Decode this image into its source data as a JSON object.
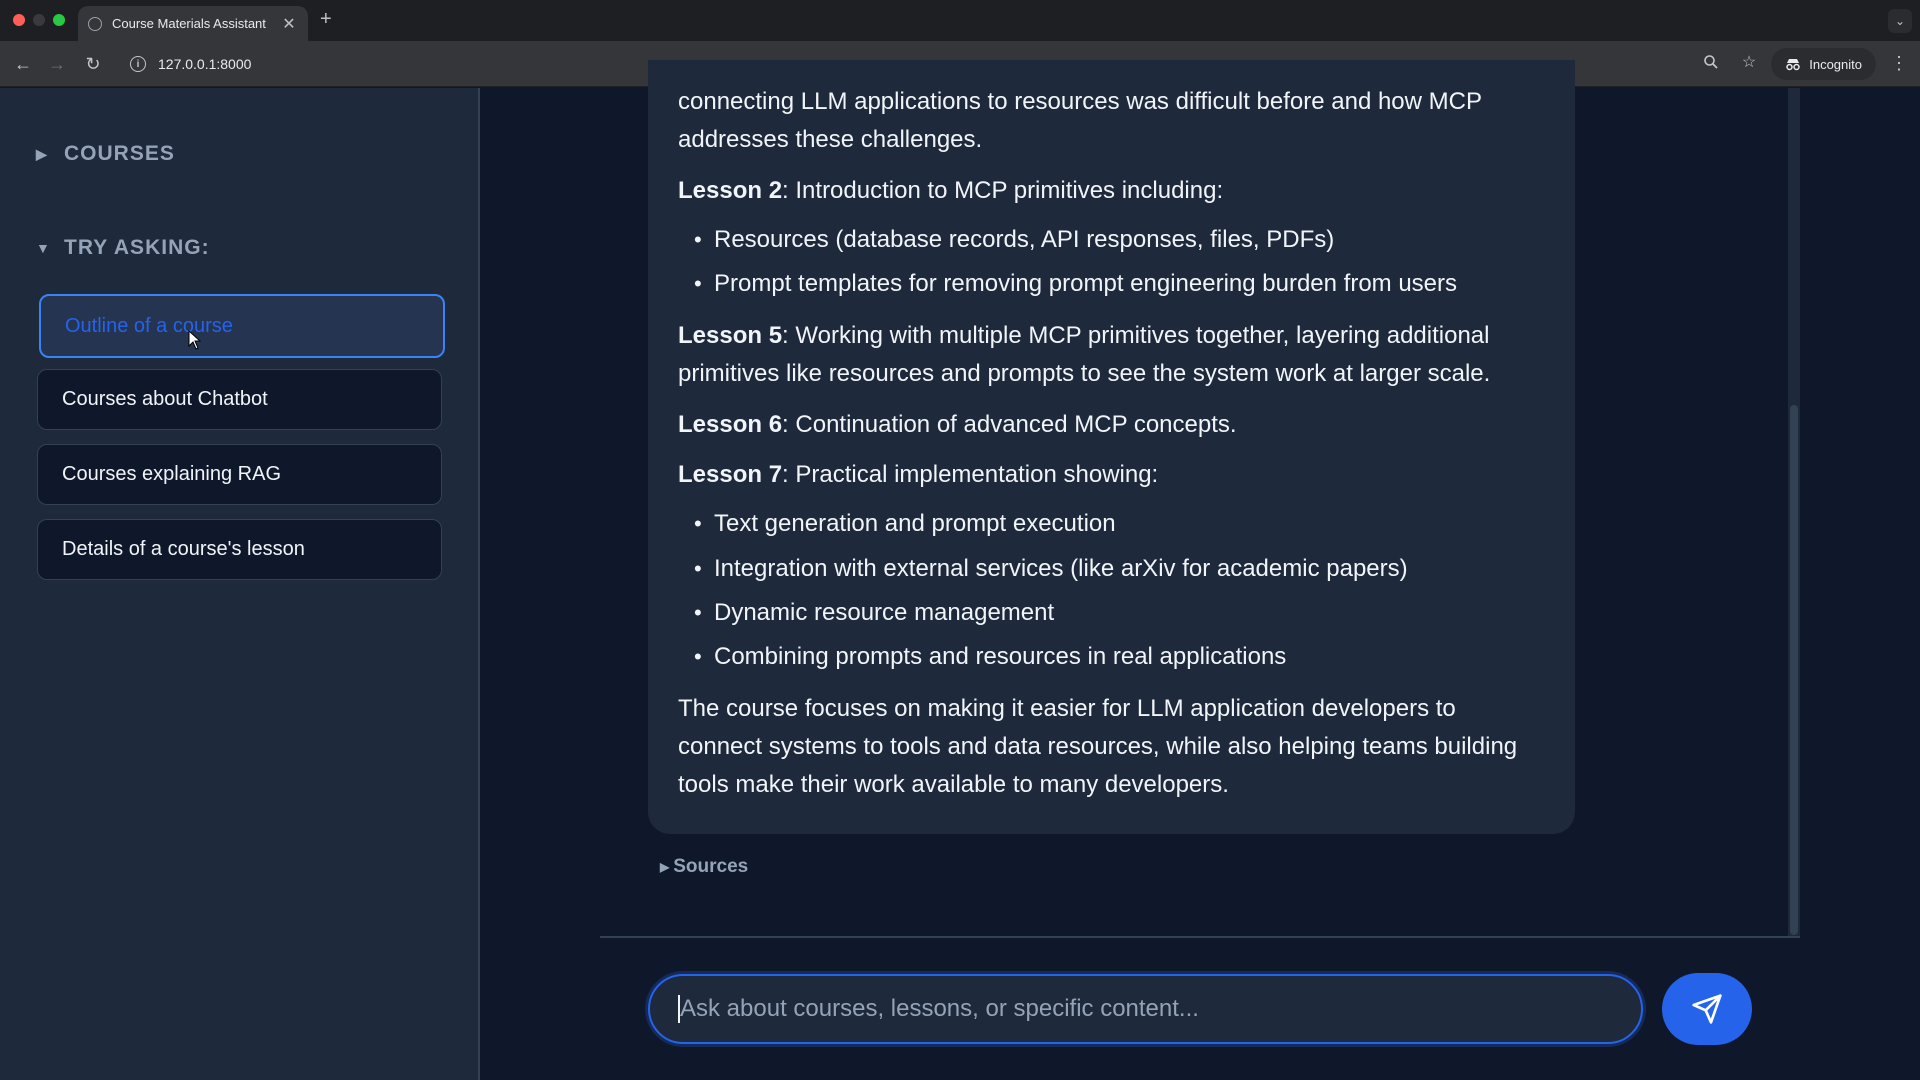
{
  "browser": {
    "tab_title": "Course Materials Assistant",
    "url": "127.0.0.1:8000",
    "incognito_label": "Incognito"
  },
  "sidebar": {
    "courses_header": "COURSES",
    "try_asking_header": "TRY ASKING:",
    "suggestions": [
      {
        "label": "Outline of a course",
        "active": true
      },
      {
        "label": "Courses about Chatbot",
        "active": false
      },
      {
        "label": "Courses explaining RAG",
        "active": false
      },
      {
        "label": "Details of a course's lesson",
        "active": false
      }
    ]
  },
  "message": {
    "intro_line1": "connecting LLM applications to resources was difficult before and how MCP",
    "intro_line2": "addresses these challenges.",
    "lesson2_label": "Lesson 2",
    "lesson2_text": ": Introduction to MCP primitives including:",
    "lesson2_bullets": [
      "Resources (database records, API responses, files, PDFs)",
      "Prompt templates for removing prompt engineering burden from users"
    ],
    "lesson5_label": "Lesson 5",
    "lesson5_line1": ": Working with multiple MCP primitives together, layering additional",
    "lesson5_line2": "primitives like resources and prompts to see the system work at larger scale.",
    "lesson6_label": "Lesson 6",
    "lesson6_text": ": Continuation of advanced MCP concepts.",
    "lesson7_label": "Lesson 7",
    "lesson7_text": ": Practical implementation showing:",
    "lesson7_bullets": [
      "Text generation and prompt execution",
      "Integration with external services (like arXiv for academic papers)",
      "Dynamic resource management",
      "Combining prompts and resources in real applications"
    ],
    "summary_line1": "The course focuses on making it easier for LLM application developers to",
    "summary_line2": "connect systems to tools and data resources, while also helping teams building",
    "summary_line3": "tools make their work available to many developers.",
    "sources_label": "Sources"
  },
  "chat_input": {
    "placeholder": "Ask about courses, lessons, or specific content...",
    "value": ""
  },
  "colors": {
    "accent": "#2563eb",
    "sidebar_bg": "#1e293b",
    "main_bg": "#0f172a"
  }
}
